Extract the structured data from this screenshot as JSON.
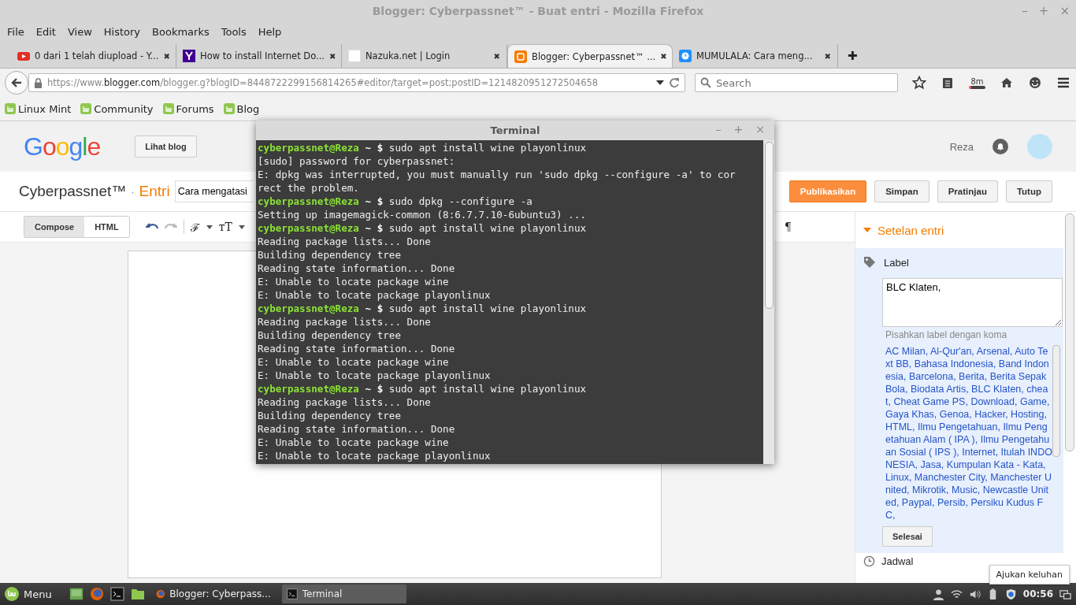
{
  "window": {
    "title": "Blogger: Cyberpassnet™ - Buat entri - Mozilla Firefox",
    "controls": [
      "–",
      "+",
      "×"
    ]
  },
  "menu": [
    "File",
    "Edit",
    "View",
    "History",
    "Bookmarks",
    "Tools",
    "Help"
  ],
  "tabs": [
    {
      "title": "0 dari 1 telah diupload - Y...",
      "close": "✖",
      "selected": false
    },
    {
      "title": "How to install Internet Do...",
      "close": "✖",
      "selected": false
    },
    {
      "title": "Nazuka.net | Login",
      "close": "✖",
      "selected": false
    },
    {
      "title": "Blogger: Cyberpassnet™ ...",
      "close": "✖",
      "selected": true
    },
    {
      "title": "MUMULALA: Cara meng...",
      "close": "✖",
      "selected": false
    }
  ],
  "new_tab": "✚",
  "url": {
    "prefix": "https://www.",
    "domain": "blogger.com",
    "rest": "/blogger.g?blogID=8448722299156814265#editor/target=post;postID=1214820951272504658"
  },
  "search": {
    "placeholder": "Search"
  },
  "toolbar_badge": "8m",
  "bookmarks": [
    "Linux Mint",
    "Community",
    "Forums",
    "Blog"
  ],
  "blogger": {
    "logo": "Google",
    "view_blog": "Lihat blog",
    "user": "Reza",
    "blog_name": "Cyberpassnet™",
    "separator": "·",
    "section": "Entri",
    "post_title": "Cara mengatasi",
    "actions": [
      {
        "label": "Publikasikan",
        "kind": "primary"
      },
      {
        "label": "Simpan",
        "kind": "plain"
      },
      {
        "label": "Pratinjau",
        "kind": "plain"
      },
      {
        "label": "Tutup",
        "kind": "plain"
      }
    ],
    "modes": [
      {
        "label": "Compose",
        "selected": true
      },
      {
        "label": "HTML",
        "selected": false
      }
    ],
    "font_glyph": "ℱ",
    "size_glyph": "тT",
    "pilcrow": "¶"
  },
  "settings": {
    "title": "Setelan entri",
    "label_title": "Label",
    "label_value": "BLC Klaten,",
    "hint": "Pisahkan label dengan koma",
    "labels": "AC Milan, Al-Qur'an, Arsenal, Auto Text BB, Bahasa Indonesia, Band Indonesia, Barcelona, Berita, Berita Sepak Bola, Biodata Artis, BLC Klaten, cheat, Cheat Game PS, Download, Game, Gaya Khas, Genoa, Hacker, Hosting, HTML, Ilmu Pengetahuan, Ilmu Pengetahuan Alam ( IPA ), Ilmu Pengetahuan Sosial ( IPS ), Internet, Itulah INDONESIA, Jasa, Kumpulan Kata - Kata, Linux, Manchester City, Manchester United, Mikrotik, Music, Newcastle United, Paypal, Persib, Persiku Kudus FC,",
    "done": "Selesai",
    "next_section": "Jadwal"
  },
  "tooltip": "Ajukan keluhan",
  "terminal": {
    "title": "Terminal",
    "controls": [
      "–",
      "+",
      "×"
    ],
    "lines": [
      {
        "kind": "prompt",
        "user": "cyberpassnet@Reza",
        "path": "~",
        "symbol": "$",
        "text": "sudo apt install wine playonlinux"
      },
      {
        "kind": "output",
        "text": "[sudo] password for cyberpassnet:"
      },
      {
        "kind": "output",
        "text": "E: dpkg was interrupted, you must manually run 'sudo dpkg --configure -a' to correct the problem."
      },
      {
        "kind": "prompt",
        "user": "cyberpassnet@Reza",
        "path": "~",
        "symbol": "$",
        "text": "sudo dpkg --configure -a"
      },
      {
        "kind": "output",
        "text": "Setting up imagemagick-common (8:6.7.7.10-6ubuntu3) ..."
      },
      {
        "kind": "prompt",
        "user": "cyberpassnet@Reza",
        "path": "~",
        "symbol": "$",
        "text": "sudo apt install wine playonlinux"
      },
      {
        "kind": "output",
        "text": "Reading package lists... Done"
      },
      {
        "kind": "output",
        "text": "Building dependency tree"
      },
      {
        "kind": "output",
        "text": "Reading state information... Done"
      },
      {
        "kind": "output",
        "text": "E: Unable to locate package wine"
      },
      {
        "kind": "output",
        "text": "E: Unable to locate package playonlinux"
      },
      {
        "kind": "prompt",
        "user": "cyberpassnet@Reza",
        "path": "~",
        "symbol": "$",
        "text": "sudo apt install wine playonlinux"
      },
      {
        "kind": "output",
        "text": "Reading package lists... Done"
      },
      {
        "kind": "output",
        "text": "Building dependency tree"
      },
      {
        "kind": "output",
        "text": "Reading state information... Done"
      },
      {
        "kind": "output",
        "text": "E: Unable to locate package wine"
      },
      {
        "kind": "output",
        "text": "E: Unable to locate package playonlinux"
      },
      {
        "kind": "prompt",
        "user": "cyberpassnet@Reza",
        "path": "~",
        "symbol": "$",
        "text": "sudo apt install wine playonlinux"
      },
      {
        "kind": "output",
        "text": "Reading package lists... Done"
      },
      {
        "kind": "output",
        "text": "Building dependency tree"
      },
      {
        "kind": "output",
        "text": "Reading state information... Done"
      },
      {
        "kind": "output",
        "text": "E: Unable to locate package wine"
      },
      {
        "kind": "output",
        "text": "E: Unable to locate package playonlinux"
      }
    ]
  },
  "taskbar": {
    "menu": "Menu",
    "windows": [
      {
        "title": "Blogger: Cyberpass...",
        "selected": false
      },
      {
        "title": "Terminal",
        "selected": true
      }
    ],
    "clock": "00:56"
  }
}
